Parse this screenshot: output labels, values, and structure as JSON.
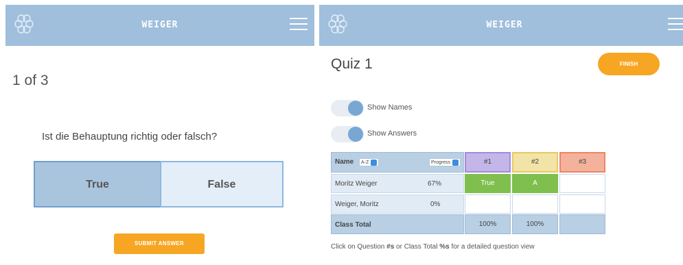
{
  "left": {
    "brand": "WEIGER",
    "counter": "1 of 3",
    "question": "Ist die Behauptung richtig oder falsch?",
    "options": [
      "True",
      "False"
    ],
    "submit_label": "SUBMIT ANSWER"
  },
  "right": {
    "brand": "WEIGER",
    "quiz_title": "Quiz 1",
    "finish_label": "FINISH",
    "toggles": [
      {
        "label": "Show Names",
        "on": true
      },
      {
        "label": "Show Answers",
        "on": true
      }
    ],
    "table": {
      "name_header": "Name",
      "sort_select": "A-Z",
      "progress_select": "Progress",
      "questions": [
        "#1",
        "#2",
        "#3"
      ],
      "rows": [
        {
          "name": "Moritz Weiger",
          "progress": "67%",
          "answers": [
            "True",
            "A",
            ""
          ]
        },
        {
          "name": "Weiger, Moritz",
          "progress": "0%",
          "answers": [
            "",
            "",
            ""
          ]
        }
      ],
      "total": {
        "label": "Class Total",
        "values": [
          "100%",
          "100%",
          ""
        ]
      }
    },
    "footnote": {
      "part1": "Click on Question ",
      "bold1": "#s",
      "part2": " or Class Total ",
      "bold2": "%s",
      "part3": " for a detailed question view"
    }
  },
  "colors": {
    "header": "#9fbfdc",
    "accent": "#f6a623",
    "correct": "#7fbf4e",
    "q1": "#c4b6e8",
    "q2": "#f2e3a7",
    "q3": "#f4b29c"
  },
  "icons": [
    "hexagon-logo-icon",
    "hamburger-menu-icon"
  ]
}
